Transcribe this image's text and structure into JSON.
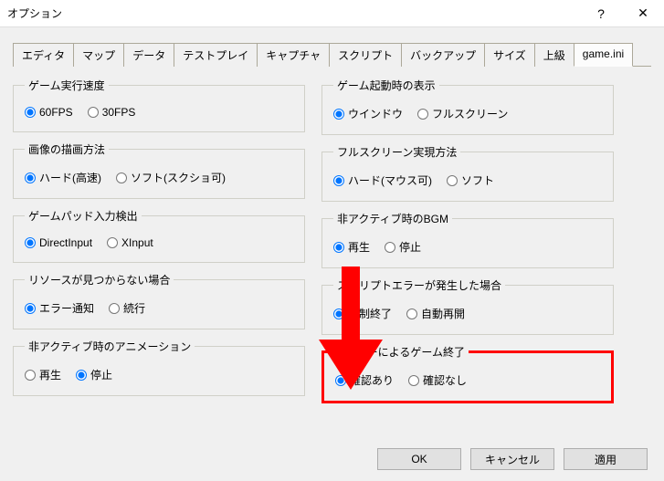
{
  "window": {
    "title": "オプション",
    "help": "?",
    "close": "✕"
  },
  "tabs": {
    "items": [
      "エディタ",
      "マップ",
      "データ",
      "テストプレイ",
      "キャプチャ",
      "スクリプト",
      "バックアップ",
      "サイズ",
      "上級",
      "game.ini"
    ],
    "active": 9
  },
  "groups": {
    "speed": {
      "legend": "ゲーム実行速度",
      "opt1": "60FPS",
      "opt2": "30FPS",
      "sel": 0
    },
    "startup": {
      "legend": "ゲーム起動時の表示",
      "opt1": "ウインドウ",
      "opt2": "フルスクリーン",
      "sel": 0
    },
    "draw": {
      "legend": "画像の描画方法",
      "opt1": "ハード(高速)",
      "opt2": "ソフト(スクショ可)",
      "sel": 0
    },
    "fs": {
      "legend": "フルスクリーン実現方法",
      "opt1": "ハード(マウス可)",
      "opt2": "ソフト",
      "sel": 0
    },
    "pad": {
      "legend": "ゲームパッド入力検出",
      "opt1": "DirectInput",
      "opt2": "XInput",
      "sel": 0
    },
    "bgm": {
      "legend": "非アクティブ時のBGM",
      "opt1": "再生",
      "opt2": "停止",
      "sel": 0
    },
    "resource": {
      "legend": "リソースが見つからない場合",
      "opt1": "エラー通知",
      "opt2": "続行",
      "sel": 0
    },
    "scripterr": {
      "legend": "スクリプトエラーが発生した場合",
      "opt1": "強制終了",
      "opt2": "自動再開",
      "sel": 0
    },
    "anim": {
      "legend": "非アクティブ時のアニメーション",
      "opt1": "再生",
      "opt2": "停止",
      "sel": 1
    },
    "esc": {
      "legend": "escキーによるゲーム終了",
      "opt1": "確認あり",
      "opt2": "確認なし",
      "sel": 0
    }
  },
  "buttons": {
    "ok": "OK",
    "cancel": "キャンセル",
    "apply": "適用"
  }
}
